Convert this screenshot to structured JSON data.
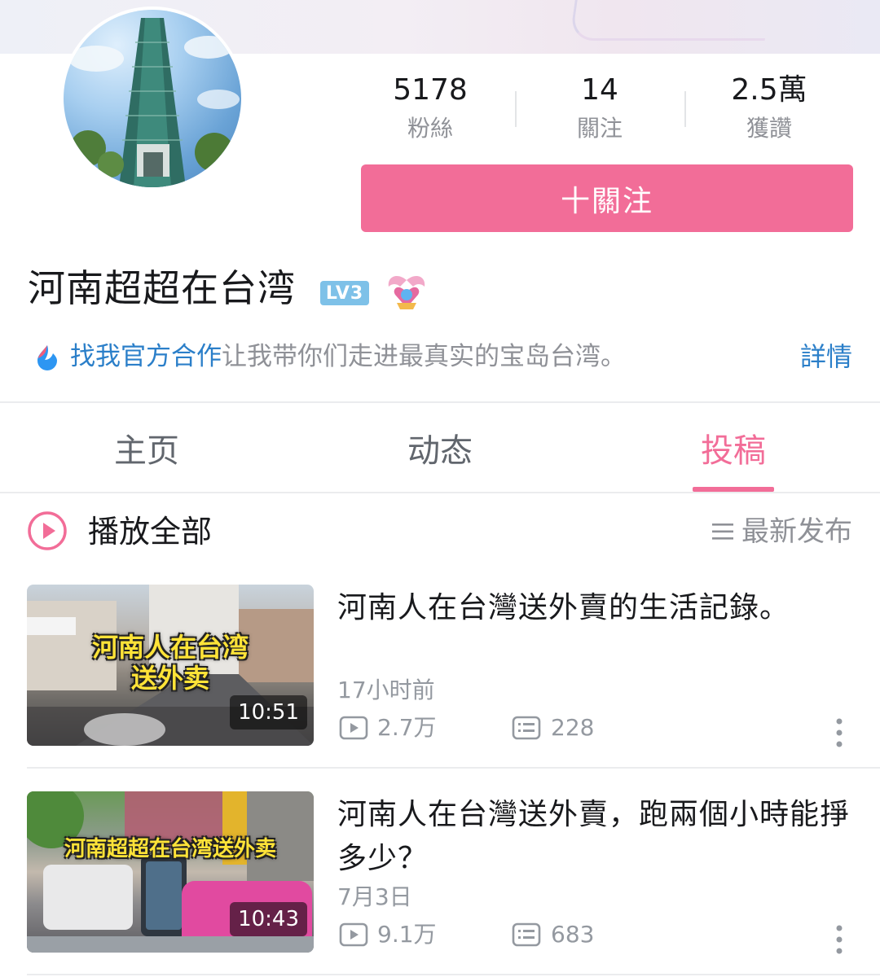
{
  "profile": {
    "name": "河南超超在台湾",
    "level": "LV3",
    "stats": [
      {
        "value": "5178",
        "label": "粉絲"
      },
      {
        "value": "14",
        "label": "關注"
      },
      {
        "value": "2.5萬",
        "label": "獲讚"
      }
    ],
    "follow_label": "十關注",
    "bio_link": "找我官方合作",
    "bio_text": "让我带你们走进最真实的宝岛台湾。",
    "detail_label": "詳情"
  },
  "tabs": [
    {
      "label": "主页",
      "active": false
    },
    {
      "label": "动态",
      "active": false
    },
    {
      "label": "投稿",
      "active": true
    }
  ],
  "list_header": {
    "play_all_label": "播放全部",
    "sort_label": "最新发布"
  },
  "videos": [
    {
      "title": "河南人在台灣送外賣的生活記錄。",
      "thumbnail_caption_1": "河南人在台湾",
      "thumbnail_caption_2": "送外卖",
      "duration": "10:51",
      "date": "17小时前",
      "views": "2.7万",
      "comments": "228"
    },
    {
      "title": "河南人在台灣送外賣，跑兩個小時能掙多少？",
      "thumbnail_caption_1": "河南超超在台湾送外卖",
      "duration": "10:43",
      "date": "7月3日",
      "views": "9.1万",
      "comments": "683"
    }
  ],
  "colors": {
    "accent": "#f26d98",
    "link": "#2b7fc9",
    "muted": "#8f9197",
    "level_badge": "#7ec1e8"
  }
}
